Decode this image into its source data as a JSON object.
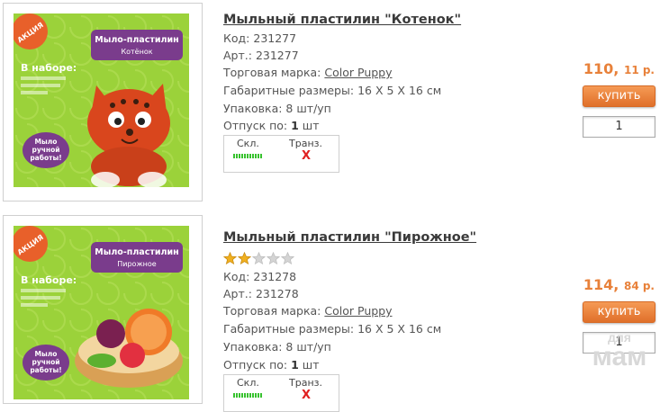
{
  "products": [
    {
      "title": "Мыльный пластилин \"Котенок\"",
      "code_label": "Код:",
      "code": "231277",
      "art_label": "Арт.:",
      "art": "231277",
      "brand_label": "Торговая марка:",
      "brand": "Color Puppy",
      "size_label": "Габаритные размеры:",
      "size": "16 X 5 X 16 см",
      "pack_label": "Упаковка:",
      "pack": "8 шт/уп",
      "release_label": "Отпуск по:",
      "release_qty": "1",
      "release_unit": "шт",
      "stock": {
        "col1": "Скл.",
        "col2": "Транз.",
        "transit_mark": "X",
        "stock_level": 1.0
      },
      "price_main": "110,",
      "price_kop": "11 р.",
      "buy_label": "купить",
      "qty_value": "1",
      "image": {
        "badge": "АКЦИЯ",
        "box_title": "Мыло-пластилин",
        "box_subtitle": "Котёнок",
        "set_label": "В наборе:",
        "handmade": "Мыло ручной работы!"
      }
    },
    {
      "title": "Мыльный пластилин  \"Пирожное\"",
      "rating": 2,
      "rating_max": 5,
      "code_label": "Код:",
      "code": "231278",
      "art_label": "Арт.:",
      "art": "231278",
      "brand_label": "Торговая марка:",
      "brand": "Color Puppy",
      "size_label": "Габаритные размеры:",
      "size": "16 X 5 X 16 см",
      "pack_label": "Упаковка:",
      "pack": "8 шт/уп",
      "release_label": "Отпуск по:",
      "release_qty": "1",
      "release_unit": "шт",
      "stock": {
        "col1": "Скл.",
        "col2": "Транз.",
        "transit_mark": "X",
        "stock_level": 1.0
      },
      "price_main": "114,",
      "price_kop": "84 р.",
      "buy_label": "купить",
      "qty_value": "1",
      "image": {
        "badge": "АКЦИЯ",
        "box_title": "Мыло-пластилин",
        "box_subtitle": "Пирожное",
        "set_label": "В наборе:",
        "handmade": "Мыло ручной работы!"
      }
    }
  ],
  "watermark": {
    "line1": "для",
    "line2": "мам"
  },
  "colors": {
    "price": "#e8813a",
    "buy_button": "#ee7f35",
    "stock_bar": "#37c22e",
    "transit_x": "#e02020",
    "box_green": "#9bd23a"
  }
}
